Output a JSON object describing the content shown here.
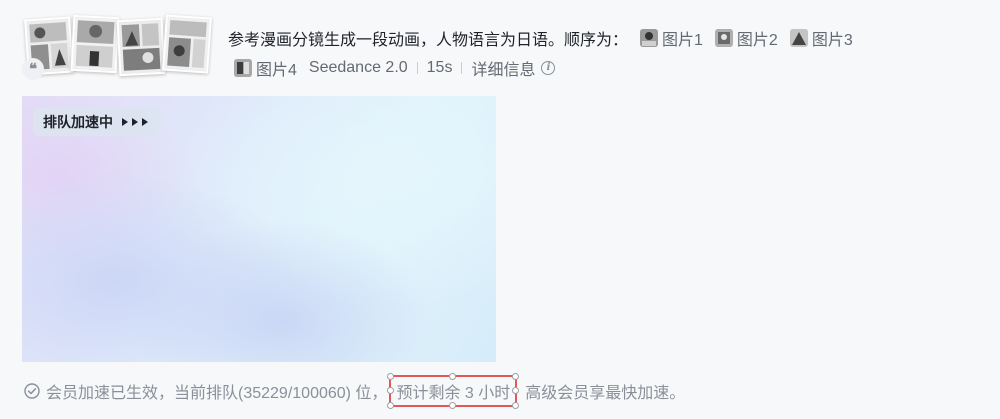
{
  "prompt": {
    "text": "参考漫画分镜生成一段动画，人物语言为日语。顺序为：",
    "references": [
      {
        "label": "图片1",
        "icon": "manga-thumbnail-icon"
      },
      {
        "label": "图片2",
        "icon": "manga-thumbnail-icon"
      },
      {
        "label": "图片3",
        "icon": "manga-thumbnail-icon"
      },
      {
        "label": "图片4",
        "icon": "manga-thumbnail-icon"
      }
    ]
  },
  "meta": {
    "model": "Seedance 2.0",
    "duration": "15s",
    "details_label": "详细信息"
  },
  "preview": {
    "queue_badge": "排队加速中"
  },
  "status": {
    "prefix": "会员加速已生效，当前排队(35229/100060) 位，",
    "highlight": "预计剩余 3 小时",
    "suffix": "高级会员享最快加速。"
  },
  "colors": {
    "highlight_border": "#e2575a",
    "muted_text": "#8a9099",
    "primary_text": "#1f2329"
  }
}
